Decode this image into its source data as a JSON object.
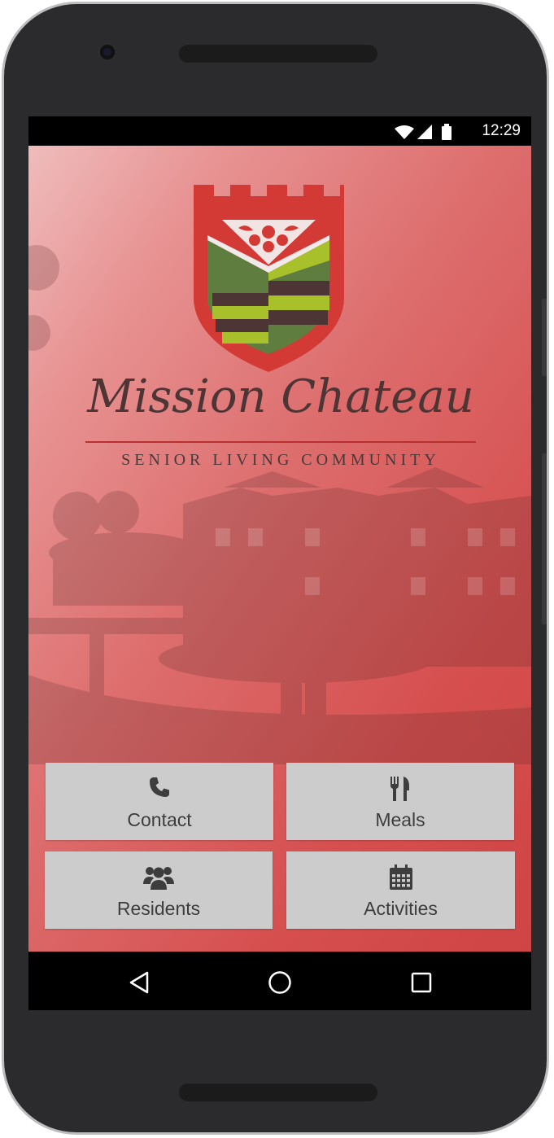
{
  "status_bar": {
    "time": "12:29",
    "icons": [
      "wifi-icon",
      "signal-icon",
      "battery-icon"
    ]
  },
  "brand": {
    "title": "Mission Chateau",
    "subtitle": "SENIOR LIVING COMMUNITY"
  },
  "tiles": [
    {
      "label": "Contact",
      "icon": "phone-icon"
    },
    {
      "label": "Meals",
      "icon": "fork-knife-icon"
    },
    {
      "label": "Residents",
      "icon": "users-icon"
    },
    {
      "label": "Activities",
      "icon": "calendar-icon"
    }
  ],
  "nav": {
    "buttons": [
      "back-icon",
      "home-icon",
      "recents-icon"
    ]
  },
  "colors": {
    "background_red": "#d64f4f",
    "tile_bg": "#cccccc",
    "crest_red": "#d33a35",
    "crest_green": "#5f7d3f",
    "crest_lime": "#a8c12b",
    "crest_brown": "#4d3535"
  }
}
